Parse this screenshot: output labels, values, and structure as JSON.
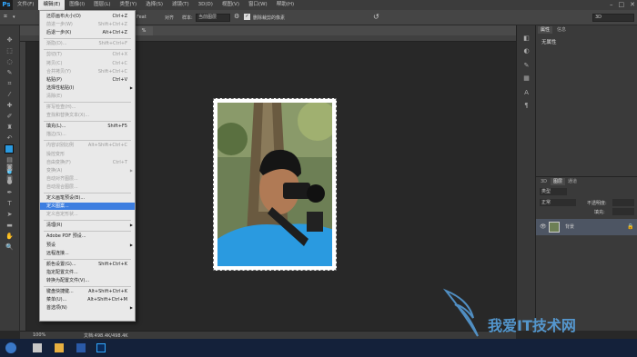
{
  "app": {
    "logo": "Ps"
  },
  "menubar": {
    "items": [
      "文件(F)",
      "编辑(E)",
      "图像(I)",
      "图层(L)",
      "类型(Y)",
      "选择(S)",
      "滤镜(T)",
      "3D(D)",
      "视图(V)",
      "窗口(W)",
      "帮助(H)"
    ]
  },
  "window_controls": {
    "minimize": "–",
    "maximize": "□",
    "close": "✕"
  },
  "options": {
    "feather_label": "Feat",
    "aa_label": "对齐",
    "sample_label": "样本:",
    "sample_value": "当前图层",
    "checkbox_label": "删除裁剪的像素",
    "workspace_value": "3D"
  },
  "document": {
    "tab_label": "%"
  },
  "status": {
    "zoom": "100%",
    "doc_info": "文档:498.4K/498.4K"
  },
  "menu": {
    "items": [
      {
        "label": "还原画布大小(O)",
        "shortcut": "Ctrl+Z",
        "state": "en"
      },
      {
        "label": "前进一步(W)",
        "shortcut": "Shift+Ctrl+Z",
        "state": "dis"
      },
      {
        "label": "后退一步(K)",
        "shortcut": "Alt+Ctrl+Z",
        "state": "en"
      },
      {
        "label": "渐隐(D)...",
        "shortcut": "Shift+Ctrl+F",
        "state": "dis"
      },
      {
        "label": "剪切(T)",
        "shortcut": "Ctrl+X",
        "state": "dis"
      },
      {
        "label": "拷贝(C)",
        "shortcut": "Ctrl+C",
        "state": "dis"
      },
      {
        "label": "合并拷贝(Y)",
        "shortcut": "Shift+Ctrl+C",
        "state": "dis"
      },
      {
        "label": "粘贴(P)",
        "shortcut": "Ctrl+V",
        "state": "en"
      },
      {
        "label": "选择性粘贴(I)",
        "shortcut": "",
        "state": "en",
        "arrow": "▶"
      },
      {
        "label": "清除(E)",
        "shortcut": "",
        "state": "dis"
      },
      {
        "label": "拼写检查(H)...",
        "shortcut": "",
        "state": "dis"
      },
      {
        "label": "查找和替换文本(X)...",
        "shortcut": "",
        "state": "dis"
      },
      {
        "label": "填充(L)...",
        "shortcut": "Shift+F5",
        "state": "en"
      },
      {
        "label": "描边(S)...",
        "shortcut": "",
        "state": "dis"
      },
      {
        "label": "内容识别比例",
        "shortcut": "Alt+Shift+Ctrl+C",
        "state": "dis"
      },
      {
        "label": "操控变形",
        "shortcut": "",
        "state": "dis"
      },
      {
        "label": "自由变换(F)",
        "shortcut": "Ctrl+T",
        "state": "dis"
      },
      {
        "label": "变换(A)",
        "shortcut": "",
        "state": "dis",
        "arrow": "▶"
      },
      {
        "label": "自动对齐图层...",
        "shortcut": "",
        "state": "dis"
      },
      {
        "label": "自动混合图层...",
        "shortcut": "",
        "state": "dis"
      },
      {
        "label": "定义画笔预设(B)...",
        "shortcut": "",
        "state": "en"
      },
      {
        "label": "定义图案...",
        "shortcut": "",
        "state": "hl"
      },
      {
        "label": "定义自定形状...",
        "shortcut": "",
        "state": "dis"
      },
      {
        "label": "清理(R)",
        "shortcut": "",
        "state": "en",
        "arrow": "▶"
      },
      {
        "label": "Adobe PDF 预设...",
        "shortcut": "",
        "state": "en"
      },
      {
        "label": "预设",
        "shortcut": "",
        "state": "en",
        "arrow": "▶"
      },
      {
        "label": "远程连接...",
        "shortcut": "",
        "state": "en"
      },
      {
        "label": "颜色设置(G)...",
        "shortcut": "Shift+Ctrl+K",
        "state": "en"
      },
      {
        "label": "指定配置文件...",
        "shortcut": "",
        "state": "en"
      },
      {
        "label": "转换为配置文件(V)...",
        "shortcut": "",
        "state": "en"
      },
      {
        "label": "键盘快捷键...",
        "shortcut": "Alt+Shift+Ctrl+K",
        "state": "en"
      },
      {
        "label": "菜单(U)...",
        "shortcut": "Alt+Shift+Ctrl+M",
        "state": "en"
      },
      {
        "label": "首选项(N)",
        "shortcut": "",
        "state": "en",
        "arrow": "▶"
      }
    ]
  },
  "properties": {
    "tabs": [
      "属性",
      "信息"
    ],
    "empty_text": "无属性"
  },
  "layers": {
    "tabs": [
      "3D",
      "图层",
      "通道"
    ],
    "kind_label": "类型",
    "blend": "正常",
    "opacity_label": "不透明度:",
    "fill_label": "填充:",
    "layer_name": "背景"
  },
  "taskbar": {
    "time": ""
  },
  "watermark": {
    "text": "我爱IT技术网"
  },
  "colors": {
    "accent": "#3d7ee0",
    "fg_swatch": "#2a9ae0",
    "bg_swatch": "#ffffff"
  }
}
